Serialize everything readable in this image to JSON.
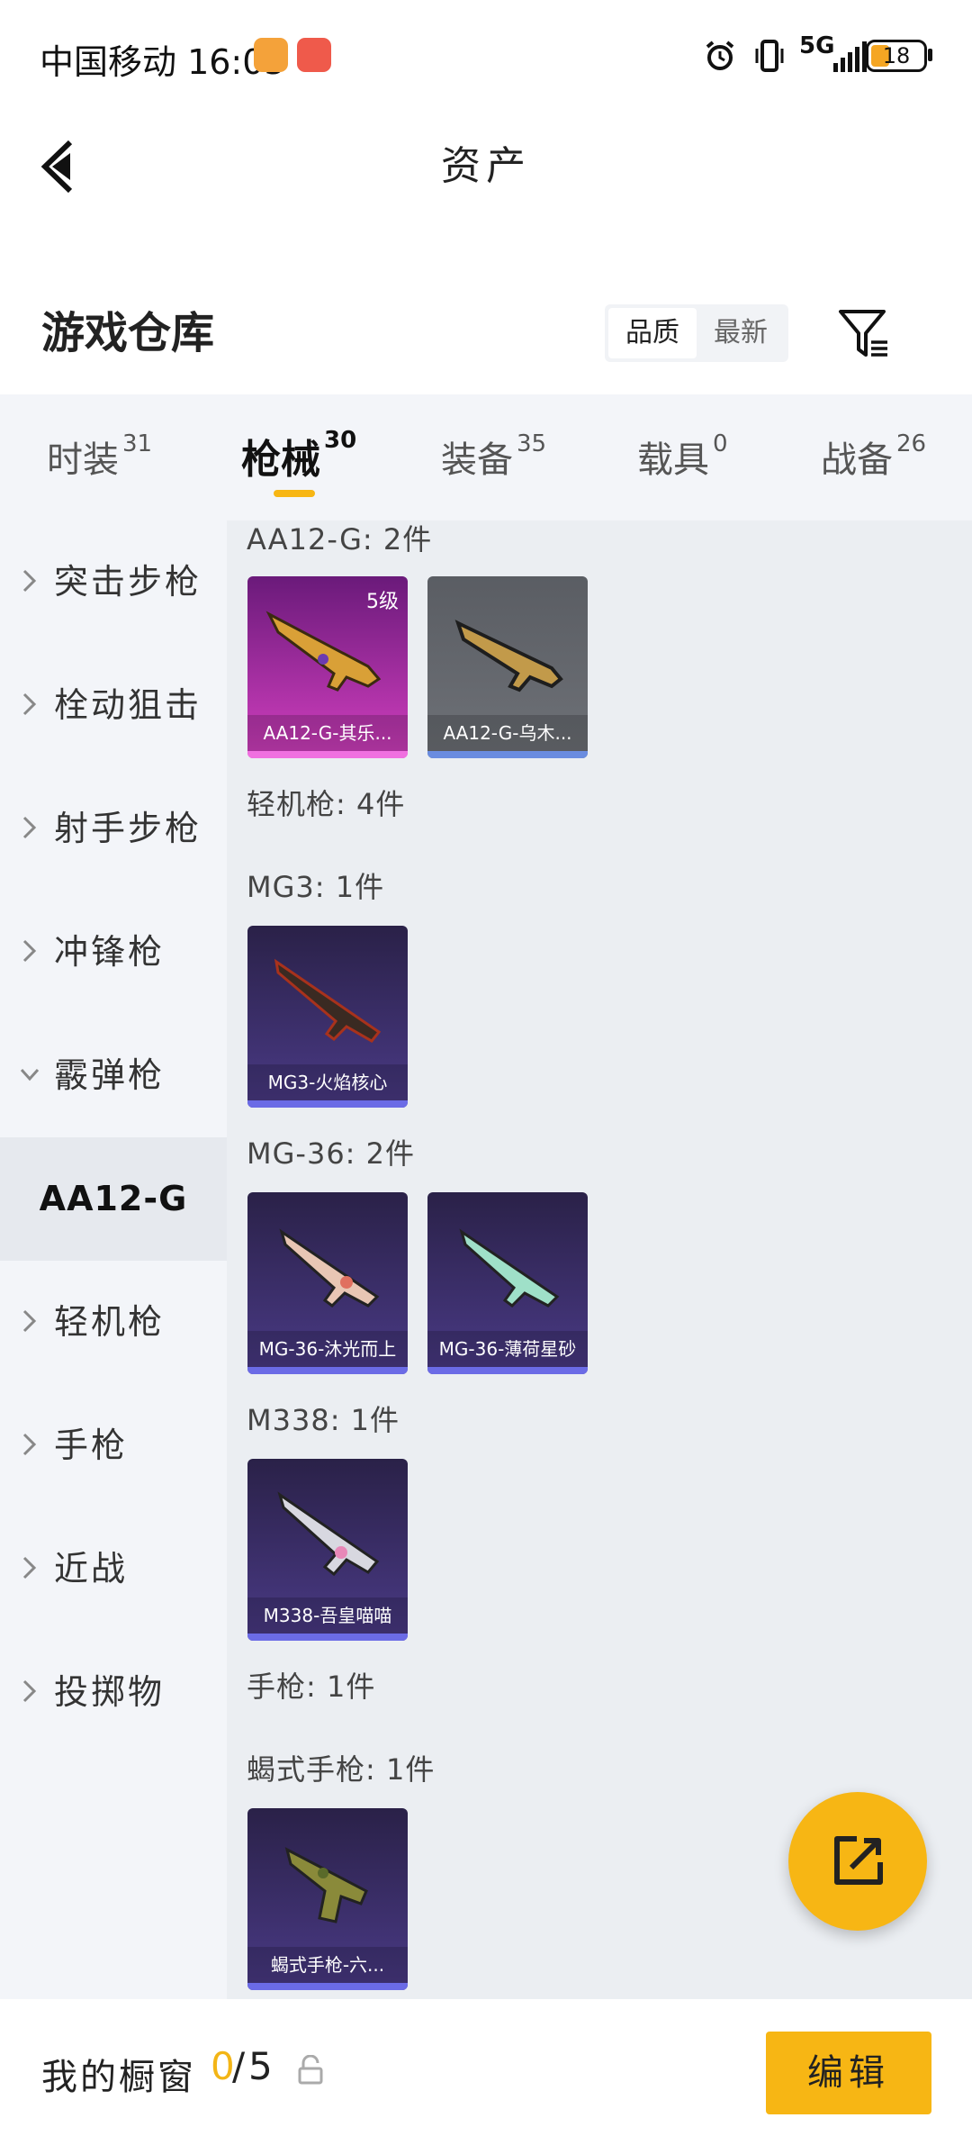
{
  "status_bar": {
    "carrier_time": "中国移动 16:05",
    "network": "5G",
    "battery": "18"
  },
  "header": {
    "title": "资产"
  },
  "section": {
    "title": "游戏仓库",
    "sort_options": [
      "品质",
      "最新"
    ]
  },
  "tabs": [
    {
      "label": "时装",
      "count": "31"
    },
    {
      "label": "枪械",
      "count": "30"
    },
    {
      "label": "装备",
      "count": "35"
    },
    {
      "label": "载具",
      "count": "0"
    },
    {
      "label": "战备",
      "count": "26"
    }
  ],
  "sidebar": {
    "items": [
      {
        "label": "突击步枪"
      },
      {
        "label": "栓动狙击"
      },
      {
        "label": "射手步枪"
      },
      {
        "label": "冲锋枪"
      },
      {
        "label": "霰弹枪"
      },
      {
        "label": "AA12-G"
      },
      {
        "label": "轻机枪"
      },
      {
        "label": "手枪"
      },
      {
        "label": "近战"
      },
      {
        "label": "投掷物"
      }
    ]
  },
  "content": {
    "groups": [
      "AA12-G: 2件",
      "轻机枪: 4件",
      "MG3: 1件",
      "MG-36: 2件",
      "M338: 1件",
      "手枪: 1件",
      "蝎式手枪: 1件"
    ],
    "cards": [
      {
        "name": "AA12-G-其乐...",
        "level": "5级",
        "color": "#c93bb8"
      },
      {
        "name": "AA12-G-乌木...",
        "color": "#6a8ce0"
      },
      {
        "name": "MG3-火焰核心",
        "color": "#7d6be0"
      },
      {
        "name": "MG-36-沐光而上",
        "color": "#7d6be0"
      },
      {
        "name": "MG-36-薄荷星砂",
        "color": "#7d6be0"
      },
      {
        "name": "M338-吾皇喵喵",
        "color": "#7d6be0"
      },
      {
        "name": "蝎式手枪-六...",
        "color": "#7d6be0"
      }
    ]
  },
  "bottom_bar": {
    "showcase_label": "我的橱窗",
    "showcase_used": "0",
    "showcase_sep": "/",
    "showcase_total": "5",
    "edit_label": "编辑"
  },
  "colors": {
    "accent": "#f7b614",
    "tab_background": "#f3f5f9",
    "content_background": "#ebeef2"
  }
}
